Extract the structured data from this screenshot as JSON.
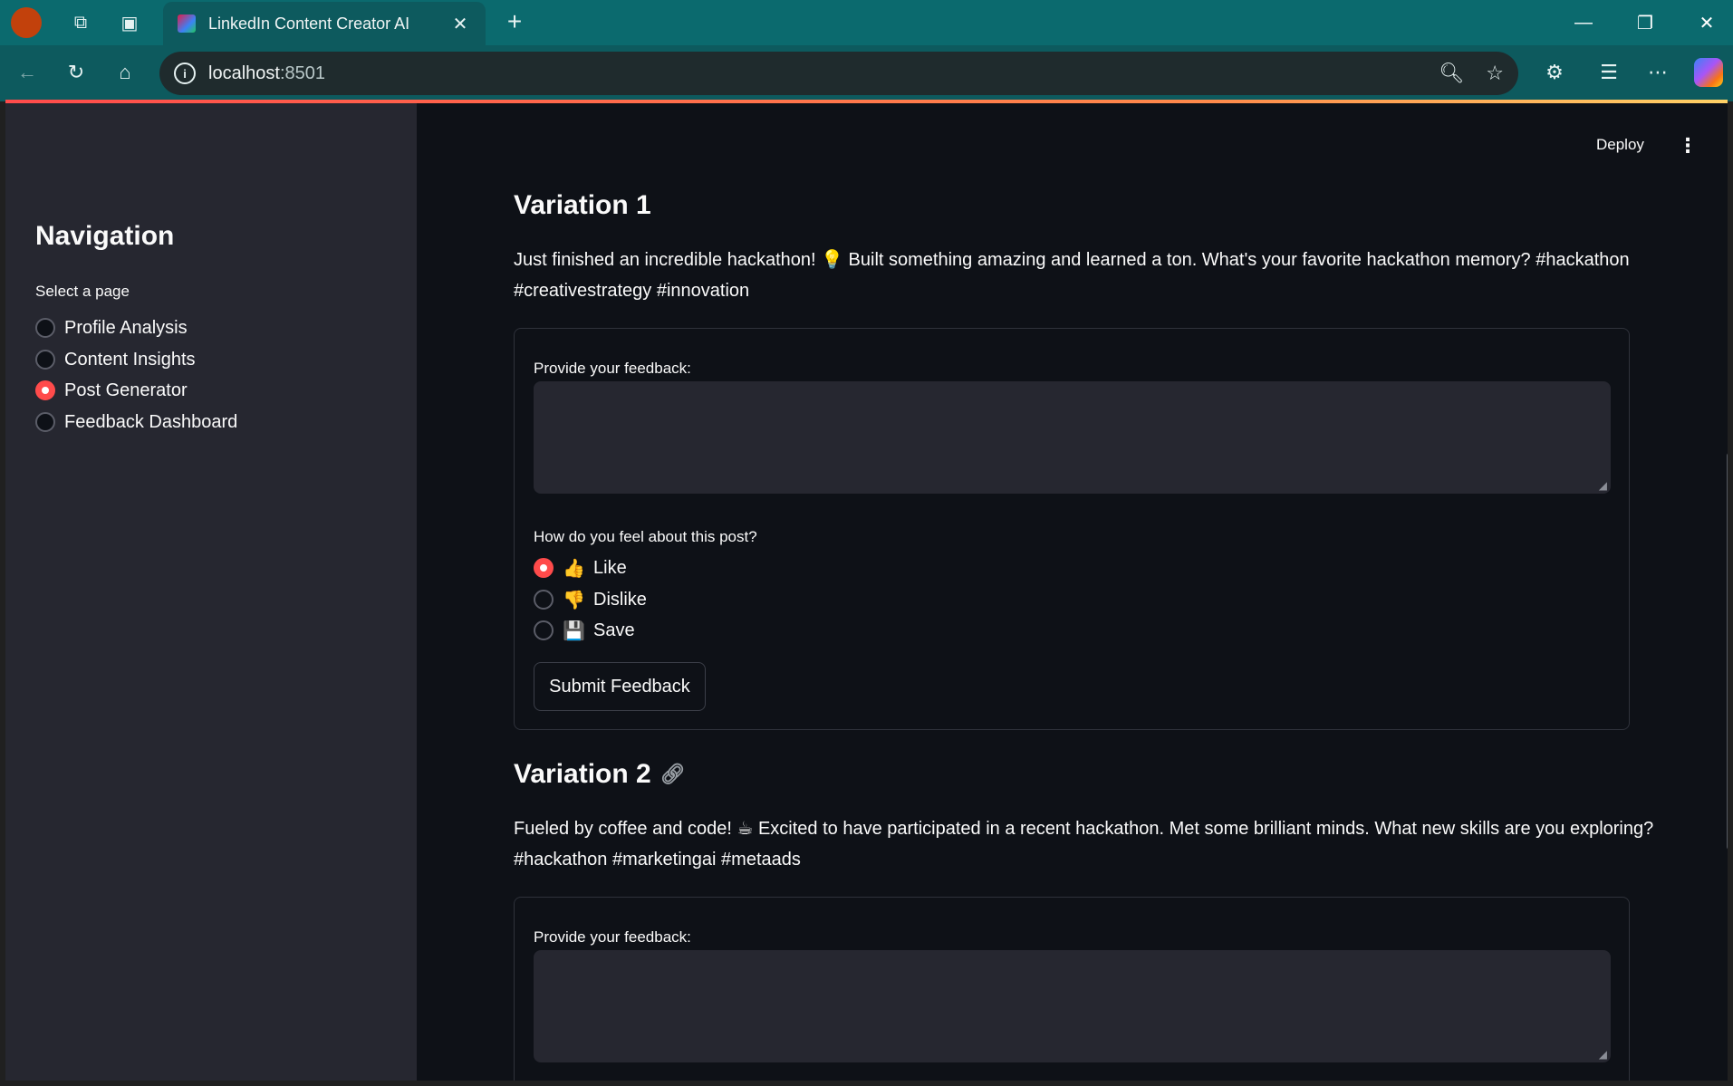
{
  "browser": {
    "tab_title": "LinkedIn Content Creator AI",
    "url_host": "localhost",
    "url_port": ":8501"
  },
  "app": {
    "deploy_label": "Deploy",
    "menu_label": "⋮"
  },
  "sidebar": {
    "title": "Navigation",
    "select_label": "Select a page",
    "items": [
      {
        "label": "Profile Analysis",
        "selected": false
      },
      {
        "label": "Content Insights",
        "selected": false
      },
      {
        "label": "Post Generator",
        "selected": true
      },
      {
        "label": "Feedback Dashboard",
        "selected": false
      }
    ]
  },
  "variations": [
    {
      "heading": "Variation 1",
      "text": "Just finished an incredible hackathon! 💡 Built something amazing and learned a ton. What's your favorite hackathon memory? #hackathon #creativestrategy #innovation",
      "feedback_label": "Provide your feedback:",
      "feel_label": "How do you feel about this post?",
      "options": [
        {
          "emoji": "👍",
          "label": "Like",
          "selected": true
        },
        {
          "emoji": "👎",
          "label": "Dislike",
          "selected": false
        },
        {
          "emoji": "💾",
          "label": "Save",
          "selected": false
        }
      ],
      "submit_label": "Submit Feedback"
    },
    {
      "heading": "Variation 2",
      "text": "Fueled by coffee and code! ☕ Excited to have participated in a recent hackathon. Met some brilliant minds. What new skills are you exploring? #hackathon #marketingai #metaads",
      "feedback_label": "Provide your feedback:"
    }
  ],
  "icons": {
    "accent": "#ff4b4b"
  }
}
